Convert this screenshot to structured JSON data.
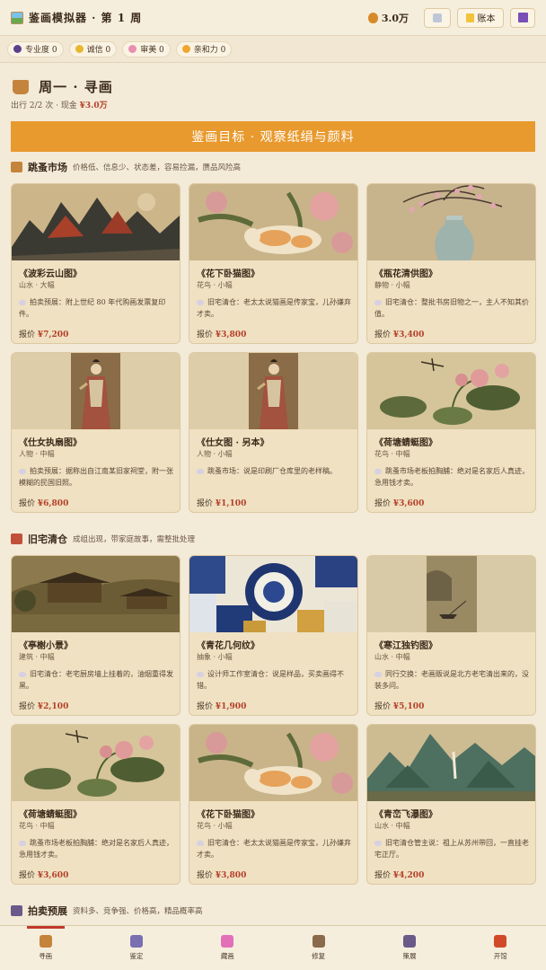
{
  "topbar": {
    "title": "鉴画模拟器 · 第 1 周",
    "money": "3.0万",
    "ledger_label": "账本"
  },
  "stats": [
    {
      "label": "专业度 0",
      "icon": "graduation-cap-icon",
      "color": "#5b3f8c"
    },
    {
      "label": "诚信 0",
      "icon": "handshake-icon",
      "color": "#e8b730"
    },
    {
      "label": "审美 0",
      "icon": "flower-icon",
      "color": "#e88fb0"
    },
    {
      "label": "亲和力 0",
      "icon": "smile-icon",
      "color": "#f0a530"
    }
  ],
  "header": {
    "title": "周一 · 寻画",
    "sub_prefix": "出行 2/2 次 · 现金",
    "cash": "¥3.0万"
  },
  "goal": "鉴画目标 · 观察纸绢与颜料",
  "sections": [
    {
      "title": "跳蚤市场",
      "desc": "价格低、信息少、状态差，容易捡漏，赝品风险高",
      "icon_color": "#c4843c",
      "cards": [
        {
          "title": "《波彩云山图》",
          "tags": "山水 · 大幅",
          "note": "拍卖预展：附上世纪 80 年代购画发票复印件。",
          "price": "¥7,200",
          "art": "mountain-red"
        },
        {
          "title": "《花下卧猫图》",
          "tags": "花鸟 · 小幅",
          "note": "旧宅清仓：老太太说猫画是传家宝，儿孙嫌弃才卖。",
          "price": "¥3,800",
          "art": "cat"
        },
        {
          "title": "《瓶花清供图》",
          "tags": "静物 · 小幅",
          "note": "旧宅清仓：整批书房旧物之一，主人不知其价值。",
          "price": "¥3,400",
          "art": "vase"
        },
        {
          "title": "《仕女执扇图》",
          "tags": "人物 · 中幅",
          "note": "拍卖预展：据称出自江南某旧家祠堂，附一张模糊的民国旧照。",
          "price": "¥6,800",
          "art": "lady"
        },
        {
          "title": "《仕女图 · 另本》",
          "tags": "人物 · 小幅",
          "note": "跳蚤市场：说是印刷厂仓库里的老样稿。",
          "price": "¥1,100",
          "art": "lady"
        },
        {
          "title": "《荷塘蜻蜓图》",
          "tags": "花鸟 · 中幅",
          "note": "跳蚤市场老板拍胸脯：绝对是名家后人真迹，急用钱才卖。",
          "price": "¥3,600",
          "art": "lotus"
        }
      ]
    },
    {
      "title": "旧宅清仓",
      "desc": "成组出现，带家庭故事，需整批处理",
      "icon_color": "#c0503a",
      "cards": [
        {
          "title": "《亭榭小景》",
          "tags": "建筑 · 中幅",
          "note": "旧宅清仓：老宅厨房墙上挂着的，油烟重得发黑。",
          "price": "¥2,100",
          "art": "pavilion"
        },
        {
          "title": "《青花几何纹》",
          "tags": "抽象 · 小幅",
          "note": "设计师工作室清仓：说是样品，买卖画得不错。",
          "price": "¥1,900",
          "art": "blue"
        },
        {
          "title": "《寒江独钓图》",
          "tags": "山水 · 中幅",
          "note": "同行交换：老画贩说是北方老宅清出来的，没装多问。",
          "price": "¥5,100",
          "art": "fisher"
        },
        {
          "title": "《荷塘蜻蜓图》",
          "tags": "花鸟 · 中幅",
          "note": "跳蚤市场老板拍胸脯：绝对是名家后人真迹，急用钱才卖。",
          "price": "¥3,600",
          "art": "lotus"
        },
        {
          "title": "《花下卧猫图》",
          "tags": "花鸟 · 小幅",
          "note": "旧宅清仓：老太太说猫画是传家宝，儿孙嫌弃才卖。",
          "price": "¥3,800",
          "art": "cat"
        },
        {
          "title": "《青峦飞瀑图》",
          "tags": "山水 · 中幅",
          "note": "旧宅清仓管主说：祖上从苏州带回，一直挂老宅正厅。",
          "price": "¥4,200",
          "art": "mountain-green"
        }
      ]
    },
    {
      "title": "拍卖预展",
      "desc": "资料多、竞争强、价格高，精品概率高",
      "icon_color": "#6a5a8a",
      "cards": []
    }
  ],
  "price_prefix": "报价",
  "nav": [
    {
      "label": "寻画",
      "icon": "basket-icon",
      "color": "#c4843c",
      "active": true
    },
    {
      "label": "鉴定",
      "icon": "microscope-icon",
      "color": "#7a6fb0",
      "active": false
    },
    {
      "label": "藏画",
      "icon": "gem-icon",
      "color": "#e36fb8",
      "active": false
    },
    {
      "label": "修复",
      "icon": "tools-icon",
      "color": "#8a6a4a",
      "active": false
    },
    {
      "label": "策展",
      "icon": "museum-icon",
      "color": "#6a5a8a",
      "active": false
    },
    {
      "label": "开馆",
      "icon": "lantern-icon",
      "color": "#d04a2a",
      "active": false
    }
  ]
}
